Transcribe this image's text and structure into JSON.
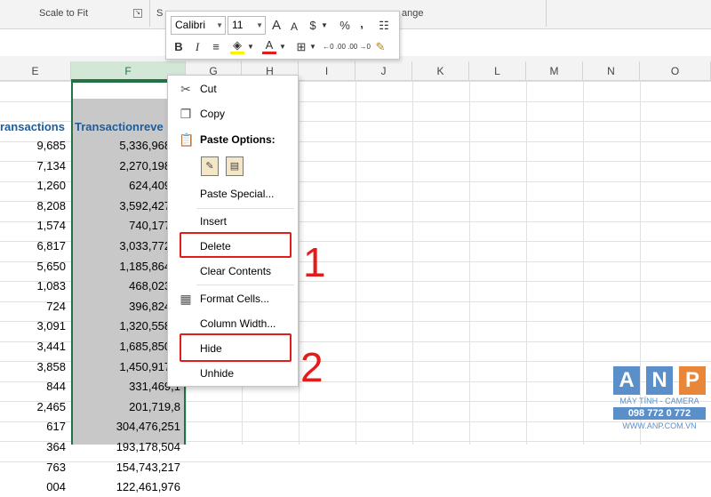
{
  "ribbon": {
    "scale_to_fit": "Scale to Fit",
    "s_label": "S",
    "arrange_fragment": "ange"
  },
  "mini_toolbar": {
    "font": "Calibri",
    "size": "11",
    "increase_font": "A",
    "decrease_font": "A",
    "currency": "$",
    "percent": "%",
    "comma": ",",
    "bold": "B",
    "italic": "I",
    "font_color": "A",
    "inc_decimal": "←0 .00",
    "dec_decimal": ".00 →0"
  },
  "columns": [
    "E",
    "F",
    "G",
    "H",
    "I",
    "J",
    "K",
    "L",
    "M",
    "N",
    "O"
  ],
  "header_row": {
    "e": "ransactions",
    "f": "Transactionreve"
  },
  "rows": [
    {
      "e": "9,685",
      "f": "5,336,968,9"
    },
    {
      "e": "7,134",
      "f": "2,270,198,6"
    },
    {
      "e": "1,260",
      "f": "624,409,8"
    },
    {
      "e": "8,208",
      "f": "3,592,427,4"
    },
    {
      "e": "1,574",
      "f": "740,177,2"
    },
    {
      "e": "6,817",
      "f": "3,033,772,5"
    },
    {
      "e": "5,650",
      "f": "1,185,864,6"
    },
    {
      "e": "1,083",
      "f": "468,023,5"
    },
    {
      "e": "724",
      "f": "396,824,6"
    },
    {
      "e": "3,091",
      "f": "1,320,558,6"
    },
    {
      "e": "3,441",
      "f": "1,685,850,5"
    },
    {
      "e": "3,858",
      "f": "1,450,917,1"
    },
    {
      "e": "844",
      "f": "331,469,1"
    },
    {
      "e": "2,465",
      "f": "201,719,8"
    },
    {
      "e": "617",
      "f": "304,476,251"
    },
    {
      "e": "364",
      "f": "193,178,504"
    },
    {
      "e": "763",
      "f": "154,743,217"
    },
    {
      "e": "004",
      "f": "122,461,976"
    }
  ],
  "context_menu": {
    "cut": "Cut",
    "copy": "Copy",
    "paste_options": "Paste Options:",
    "paste_special": "Paste Special...",
    "insert": "Insert",
    "delete": "Delete",
    "clear_contents": "Clear Contents",
    "format_cells": "Format Cells...",
    "column_width": "Column Width...",
    "hide": "Hide",
    "unhide": "Unhide"
  },
  "annotations": {
    "step1": "1",
    "step2": "2"
  },
  "watermark": {
    "letters": [
      "A",
      "N",
      "P"
    ],
    "tagline": "MÁY TÍNH - CAMERA",
    "phone": "098 772 0 772",
    "site": "WWW.ANP.COM.VN"
  },
  "colors": {
    "accent": "#217346",
    "annotation": "#e21b1b",
    "header_text": "#1f5c99",
    "selection_fill": "#c8c8c8"
  }
}
